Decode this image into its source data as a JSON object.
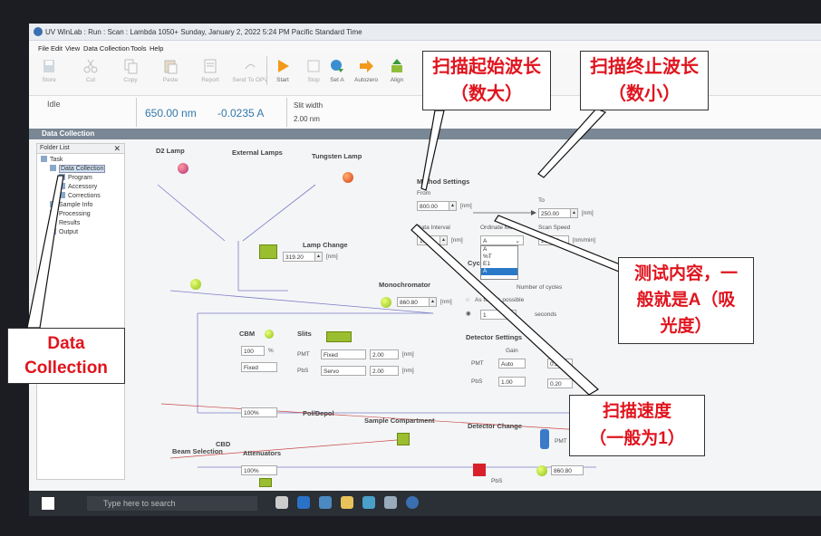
{
  "window": {
    "title": "UV WinLab : Run : Scan : Lambda 1050+ Sunday, January 2, 2022 5:24 PM Pacific Standard Time"
  },
  "menu": [
    "File",
    "Edit",
    "View",
    "Data Collection",
    "Tools",
    "Help"
  ],
  "toolbar": {
    "items": [
      {
        "label": "Store",
        "icon": "store-icon"
      },
      {
        "label": "Cut",
        "icon": "scissors-icon"
      },
      {
        "label": "Copy",
        "icon": "copy-icon"
      },
      {
        "label": "Paste",
        "icon": "paste-icon"
      },
      {
        "label": "Report",
        "icon": "report-icon"
      },
      {
        "label": "Send To OPV",
        "icon": "send-icon"
      },
      {
        "label": "Start",
        "icon": "play-icon"
      },
      {
        "label": "Stop",
        "icon": "stop-icon"
      },
      {
        "label": "Set A",
        "icon": "set-a-icon"
      },
      {
        "label": "Autozero",
        "icon": "arrow-right-icon"
      },
      {
        "label": "Align",
        "icon": "align-icon"
      }
    ]
  },
  "status": {
    "state": "Idle",
    "wavelength": "650.00 nm",
    "absorbance": "-0.0235 A",
    "slit_label": "Slit width",
    "slit_value": "2.00 nm"
  },
  "section": {
    "title": "Data Collection"
  },
  "folder": {
    "title": "Folder List",
    "items": [
      "Task",
      "Data Collection",
      "Program",
      "Accessory",
      "Corrections",
      "Sample Info",
      "Processing",
      "Results",
      "Output"
    ]
  },
  "lamps": {
    "d2": "D2 Lamp",
    "external": "External Lamps",
    "tungsten": "Tungsten Lamp",
    "change": "Lamp Change",
    "change_value": "319.20",
    "unit": "[nm]"
  },
  "method": {
    "title": "Method Settings",
    "from_label": "From",
    "from_value": "800.00",
    "to_label": "To",
    "to_value": "250.00",
    "unit": "[nm]",
    "interval_label": "Data Interval",
    "interval_value": "1.00",
    "ordinate_label": "Ordinate Mode",
    "ordinate_value": "A",
    "ordinate_options": [
      "A",
      "%T",
      "E1",
      "A"
    ],
    "speed_label": "Scan Speed",
    "speed_value": "266.75",
    "speed_unit": "[nm/min]"
  },
  "cycles": {
    "title": "Cyc",
    "num_label": "Number of cycles",
    "fast_label": "As fast as possible",
    "interval_value": "1",
    "seconds": "seconds"
  },
  "monochromator": {
    "title": "Monochromator",
    "value": "860.80",
    "unit": "[nm]"
  },
  "cbm": {
    "title": "CBM",
    "value": "100",
    "unit": "%",
    "mode": "Fixed"
  },
  "slits": {
    "title": "Slits",
    "pmt_label": "PMT",
    "pmt_mode": "Fixed",
    "pmt_value": "2.00",
    "pbs_label": "PbS",
    "pbs_mode": "Servo",
    "pbs_value": "2.00",
    "unit": "[nm]"
  },
  "detector": {
    "title": "Detector Settings",
    "gain_label": "Gain",
    "pmt_label": "PMT",
    "pmt_gain": "Auto",
    "pmt_value": "0.20",
    "pbs_label": "PbS",
    "pbs_gain": "1.00",
    "pbs_value": "0.20"
  },
  "lower": {
    "attenuators_top": "100%",
    "pol": "Pol/Depol",
    "sample": "Sample Compartment",
    "det_change": "Detector Change",
    "beam": "Beam Selection",
    "cbd": "CBD",
    "attenuators": "Attenuators",
    "att_bottom": "100%",
    "pmt": "PMT",
    "pbs": "PbS",
    "det_value": "860.80"
  },
  "callouts": {
    "start_wl": [
      "扫描起始波长",
      "（数大）"
    ],
    "end_wl": [
      "扫描终止波长",
      "（数小）"
    ],
    "ordinate": [
      "测试内容，一",
      "般就是A（吸",
      "光度）"
    ],
    "speed": [
      "扫描速度",
      "（一般为1）"
    ],
    "data_collection": [
      "Data",
      "Collection"
    ]
  },
  "taskbar": {
    "search_placeholder": "Type here to search"
  },
  "colors": {
    "callout_text": "#e0141e",
    "section_bar": "#7a8794",
    "accent": "#3377aa"
  }
}
